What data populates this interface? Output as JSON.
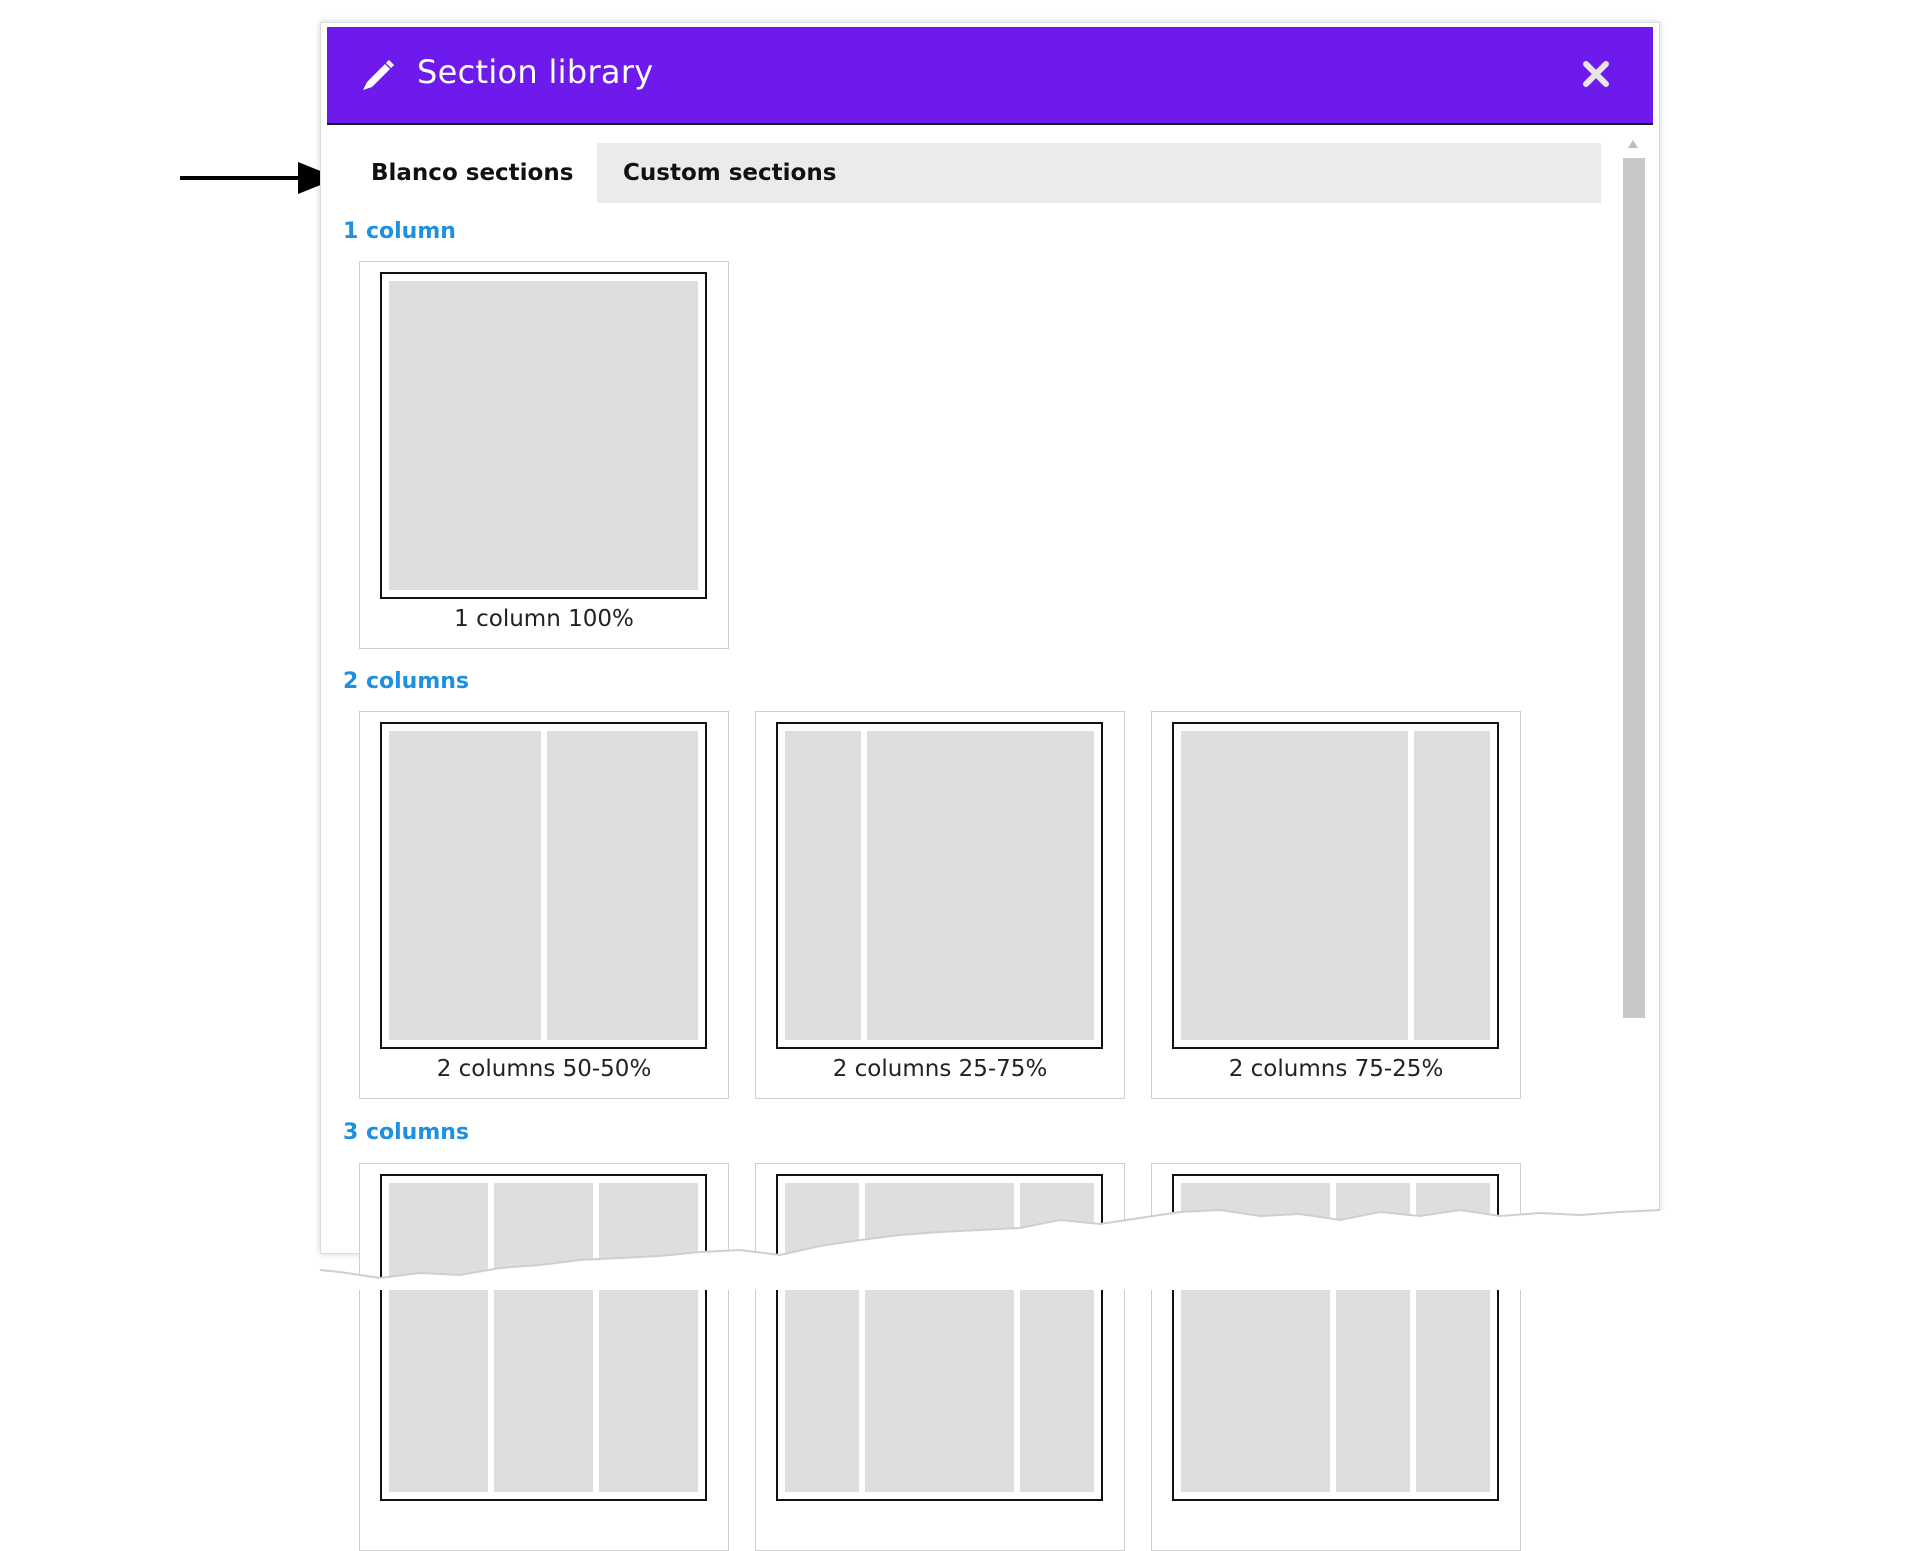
{
  "dialog": {
    "title": "Section library",
    "header_color": "#6f1aec",
    "icons": {
      "title_icon": "pencil-icon",
      "close_icon": "close-icon"
    }
  },
  "tabs": [
    {
      "label": "Blanco sections",
      "active": true
    },
    {
      "label": "Custom sections",
      "active": false
    }
  ],
  "groups": [
    {
      "heading": "1 column",
      "cards": [
        {
          "label": "1 column 100%",
          "columns": [
            100
          ]
        }
      ]
    },
    {
      "heading": "2 columns",
      "cards": [
        {
          "label": "2 columns 50-50%",
          "columns": [
            50,
            50
          ]
        },
        {
          "label": "2 columns 25-75%",
          "columns": [
            25,
            75
          ]
        },
        {
          "label": "2 columns 75-25%",
          "columns": [
            75,
            25
          ]
        }
      ]
    },
    {
      "heading": "3 columns",
      "cards": [
        {
          "columns": [
            33,
            33,
            33
          ]
        },
        {
          "columns": [
            25,
            50,
            25
          ]
        },
        {
          "columns": [
            50,
            25,
            25
          ]
        }
      ]
    }
  ],
  "colors": {
    "accent": "#1e90e0",
    "column_fill": "#dedede"
  }
}
